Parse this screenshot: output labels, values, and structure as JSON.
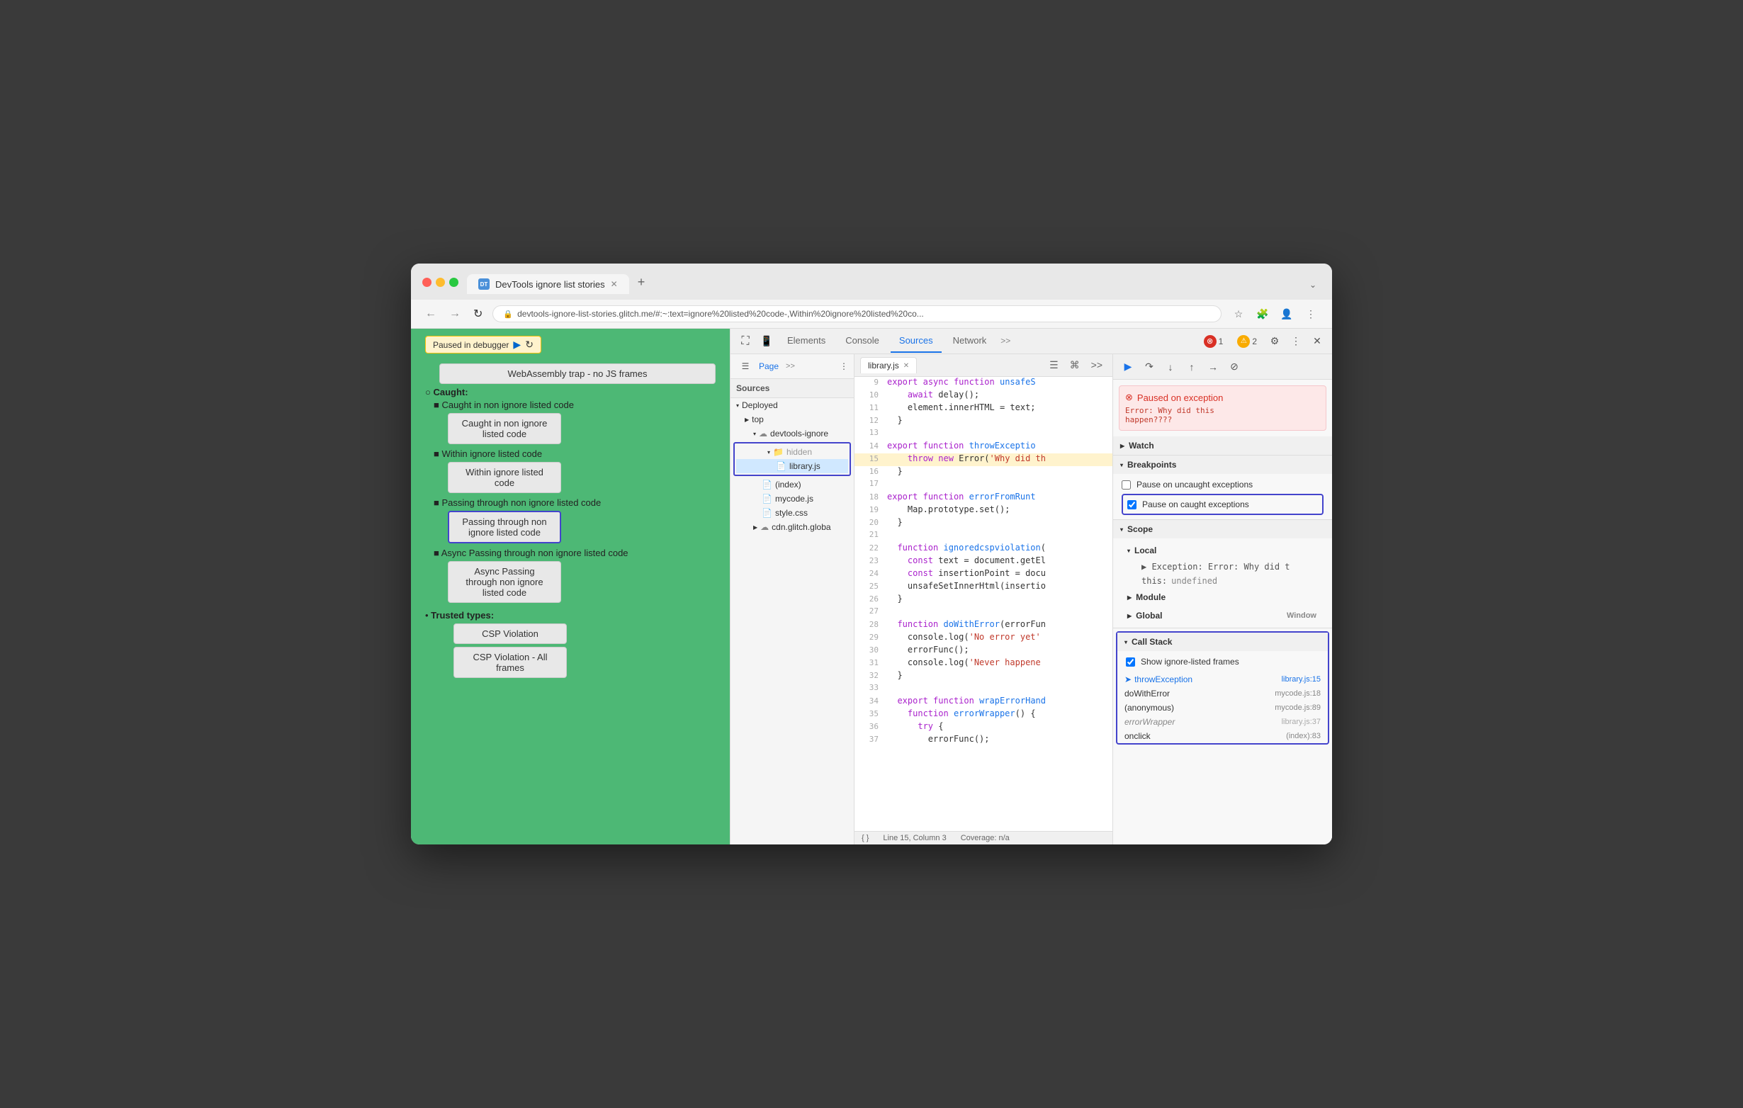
{
  "browser": {
    "tab_title": "DevTools ignore list stories",
    "tab_icon": "DT",
    "address": "devtools-ignore-list-stories.glitch.me/#:~:text=ignore%20listed%20code-,Within%20ignore%20listed%20co...",
    "paused_badge": "Paused in debugger"
  },
  "page": {
    "webassembly_text": "WebAssembly trap - no JS frames",
    "caught_label": "Caught:",
    "items": [
      {
        "label": "Caught in non ignore listed code",
        "btn_label": "Caught in non ignore\nlisted code"
      },
      {
        "label": "Within ignore listed code",
        "btn_label": "Within ignore listed\ncode"
      },
      {
        "label": "Passing through non ignore listed code",
        "btn_label": "Passing through non\nignore listed code",
        "highlighted": true
      },
      {
        "label": "Async Passing through non ignore listed code",
        "btn_label": "Async Passing\nthrough non ignore\nlisted code"
      }
    ],
    "trusted_types_label": "Trusted types:",
    "csp_violation": "CSP Violation",
    "csp_violation_all": "CSP Violation - All frames"
  },
  "devtools": {
    "tabs": [
      "Elements",
      "Console",
      "Sources",
      "Network",
      ">>"
    ],
    "active_tab": "Sources",
    "errors": "1",
    "warnings": "2",
    "sources_tabs": [
      {
        "label": "Page",
        "active": false
      },
      {
        "label": ">>",
        "active": false
      }
    ],
    "file_tree": {
      "title": "Sources",
      "deployed_label": "Deployed",
      "top_label": "top",
      "devtools_ignore_label": "devtools-ignore",
      "hidden_folder": "hidden",
      "library_js": "library.js",
      "index_label": "(index)",
      "mycode_js": "mycode.js",
      "style_css": "style.css",
      "cdn_label": "cdn.glitch.globa"
    },
    "code_file": "library.js",
    "code_lines": [
      {
        "num": 9,
        "text": "  export async function unsafeS"
      },
      {
        "num": 10,
        "text": "    await delay();"
      },
      {
        "num": 11,
        "text": "    element.innerHTML = text;"
      },
      {
        "num": 12,
        "text": "  }"
      },
      {
        "num": 13,
        "text": ""
      },
      {
        "num": 14,
        "text": "  export function throwExceptio"
      },
      {
        "num": 15,
        "text": "    throw new Error('Why did th",
        "highlighted": true
      },
      {
        "num": 16,
        "text": "  }"
      },
      {
        "num": 17,
        "text": ""
      },
      {
        "num": 18,
        "text": "  export function errorFromRunt"
      },
      {
        "num": 19,
        "text": "    Map.prototype.set();"
      },
      {
        "num": 20,
        "text": "  }"
      },
      {
        "num": 21,
        "text": ""
      },
      {
        "num": 22,
        "text": "  function ignoredcspviolation("
      },
      {
        "num": 23,
        "text": "    const text = document.getEl"
      },
      {
        "num": 24,
        "text": "    const insertionPoint = docu"
      },
      {
        "num": 25,
        "text": "    unsafeSetInnerHtml(insertio"
      },
      {
        "num": 26,
        "text": "  }"
      },
      {
        "num": 27,
        "text": ""
      },
      {
        "num": 28,
        "text": "  function doWithError(errorFun"
      },
      {
        "num": 29,
        "text": "    console.log('No error yet'"
      },
      {
        "num": 30,
        "text": "    errorFunc();"
      },
      {
        "num": 31,
        "text": "    console.log('Never happene"
      },
      {
        "num": 32,
        "text": "  }"
      },
      {
        "num": 33,
        "text": ""
      },
      {
        "num": 34,
        "text": "  export function wrapErrorHand"
      },
      {
        "num": 35,
        "text": "    function errorWrapper() {"
      },
      {
        "num": 36,
        "text": "      try {"
      },
      {
        "num": 37,
        "text": "        errorFunc();"
      }
    ],
    "status_line": "Line 15, Column 3",
    "status_coverage": "Coverage: n/a",
    "right_panel": {
      "exception_title": "Paused on exception",
      "exception_msg": "Error: Why did this\nhappen????",
      "sections": [
        {
          "label": "Watch",
          "open": false
        },
        {
          "label": "Breakpoints",
          "open": true
        },
        {
          "label": "Scope",
          "open": true,
          "sub": [
            {
              "label": "Local",
              "open": true
            },
            {
              "key": "Exception:",
              "val": "Error: Why did t",
              "sub": true
            },
            {
              "key": "this:",
              "val": "undefined",
              "sub": true
            },
            {
              "label": "Module",
              "open": false
            },
            {
              "label": "Global",
              "val": "Window"
            }
          ]
        }
      ],
      "breakpoints": {
        "pause_uncaught_label": "Pause on uncaught exceptions",
        "pause_uncaught_checked": false,
        "pause_caught_label": "Pause on caught exceptions",
        "pause_caught_checked": true
      },
      "call_stack": {
        "label": "Call Stack",
        "show_ignore_label": "Show ignore-listed frames",
        "show_ignore_checked": true,
        "frames": [
          {
            "fn": "throwException",
            "file": "library.js:15",
            "active": true
          },
          {
            "fn": "doWithError",
            "file": "mycode.js:18",
            "active": false
          },
          {
            "fn": "(anonymous)",
            "file": "mycode.js:89",
            "active": false
          },
          {
            "fn": "errorWrapper",
            "file": "library.js:37",
            "active": false,
            "grayed": true
          },
          {
            "fn": "onclick",
            "file": "(index):83",
            "active": false
          }
        ]
      }
    }
  }
}
